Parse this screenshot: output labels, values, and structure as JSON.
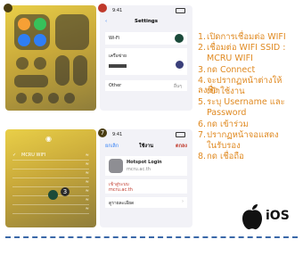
{
  "phone1": {
    "badge": ""
  },
  "phone2": {
    "badge": "",
    "time": "9:41",
    "nav_title": "Settings",
    "row_wifi_label": "Wi-Fi",
    "row_network": "เครือข่าย",
    "row_other": "Other",
    "row_other_value": "อื่นๆ"
  },
  "phone3": {
    "badge": "3",
    "rows": [
      "MCRU WIFI",
      "",
      "",
      "",
      "",
      "",
      ""
    ]
  },
  "phone4": {
    "badge": "7",
    "time": "9:41",
    "nav_cancel": "ยกเลิก",
    "nav_title": "ใช้งาน",
    "nav_done": "ตกลง",
    "profile_name": "Hotspot Login",
    "profile_sub": "mcru.ac.th",
    "row_label": "เข้าสู่ระบบ",
    "row_label_link": "mcru.ac.th",
    "footer_label": "ดูรายละเอียด"
  },
  "steps": [
    {
      "num": "1.",
      "text": "เปิดการเชื่อมต่อ WIFI"
    },
    {
      "num": "2.",
      "text": "เชื่อมต่อ WIFI SSID :"
    },
    {
      "num": "",
      "text": "MCRU WIFI"
    },
    {
      "num": "3.",
      "text": "กด Connect"
    },
    {
      "num": "4.",
      "text": "จะปรากฏหน้าต่างให้ลงชื่อ"
    },
    {
      "num": "",
      "text": "เข้าใช้งาน"
    },
    {
      "num": "5.",
      "text": "ระบุ Username และ"
    },
    {
      "num": "",
      "text": "Password"
    },
    {
      "num": "6.",
      "text": "กด เข้าร่วม"
    },
    {
      "num": "7.",
      "text": "ปรากฏหน้าจอแสดง"
    },
    {
      "num": "",
      "text": "ในรับรอง"
    },
    {
      "num": "8.",
      "text": "กด เชื่อถือ"
    }
  ],
  "logo": {
    "text": "iOS"
  },
  "colors": {
    "accent": "#e08a22",
    "dash": "#3a68a8",
    "tile_bg": "#c9a93a"
  }
}
